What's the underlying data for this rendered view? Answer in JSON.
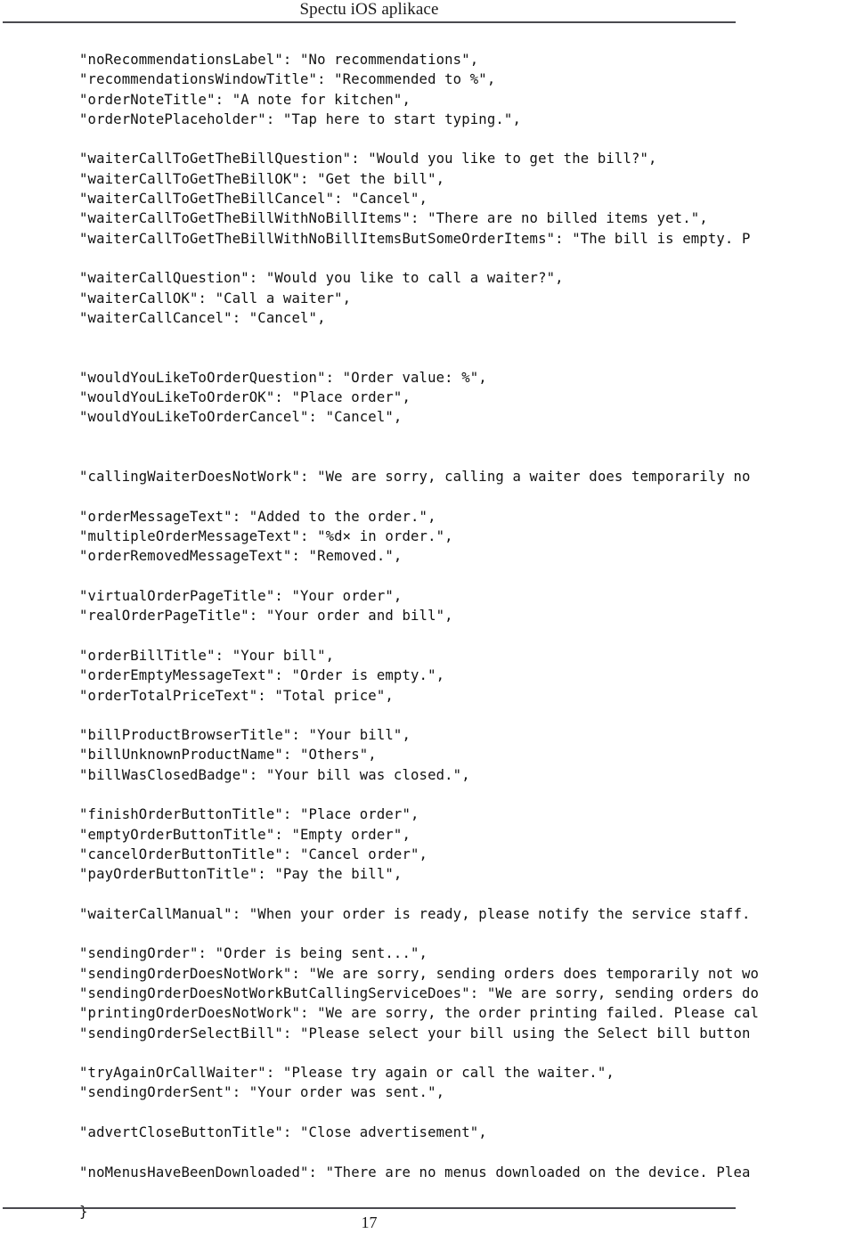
{
  "header": {
    "title": "Spectu iOS aplikace"
  },
  "footer": {
    "page_number": "17"
  },
  "code": {
    "lines": [
      "\"noRecommendationsLabel\": \"No recommendations\",",
      "\"recommendationsWindowTitle\": \"Recommended to %\",",
      "\"orderNoteTitle\": \"A note for kitchen\",",
      "\"orderNotePlaceholder\": \"Tap here to start typing.\",",
      "",
      "\"waiterCallToGetTheBillQuestion\": \"Would you like to get the bill?\",",
      "\"waiterCallToGetTheBillOK\": \"Get the bill\",",
      "\"waiterCallToGetTheBillCancel\": \"Cancel\",",
      "\"waiterCallToGetTheBillWithNoBillItems\": \"There are no billed items yet.\",",
      "\"waiterCallToGetTheBillWithNoBillItemsButSomeOrderItems\": \"The bill is empty. P",
      "",
      "\"waiterCallQuestion\": \"Would you like to call a waiter?\",",
      "\"waiterCallOK\": \"Call a waiter\",",
      "\"waiterCallCancel\": \"Cancel\",",
      "",
      "",
      "\"wouldYouLikeToOrderQuestion\": \"Order value: %\",",
      "\"wouldYouLikeToOrderOK\": \"Place order\",",
      "\"wouldYouLikeToOrderCancel\": \"Cancel\",",
      "",
      "",
      "\"callingWaiterDoesNotWork\": \"We are sorry, calling a waiter does temporarily no",
      "",
      "\"orderMessageText\": \"Added to the order.\",",
      "\"multipleOrderMessageText\": \"%d× in order.\",",
      "\"orderRemovedMessageText\": \"Removed.\",",
      "",
      "\"virtualOrderPageTitle\": \"Your order\",",
      "\"realOrderPageTitle\": \"Your order and bill\",",
      "",
      "\"orderBillTitle\": \"Your bill\",",
      "\"orderEmptyMessageText\": \"Order is empty.\",",
      "\"orderTotalPriceText\": \"Total price\",",
      "",
      "\"billProductBrowserTitle\": \"Your bill\",",
      "\"billUnknownProductName\": \"Others\",",
      "\"billWasClosedBadge\": \"Your bill was closed.\",",
      "",
      "\"finishOrderButtonTitle\": \"Place order\",",
      "\"emptyOrderButtonTitle\": \"Empty order\",",
      "\"cancelOrderButtonTitle\": \"Cancel order\",",
      "\"payOrderButtonTitle\": \"Pay the bill\",",
      "",
      "\"waiterCallManual\": \"When your order is ready, please notify the service staff.",
      "",
      "\"sendingOrder\": \"Order is being sent...\",",
      "\"sendingOrderDoesNotWork\": \"We are sorry, sending orders does temporarily not wo",
      "\"sendingOrderDoesNotWorkButCallingServiceDoes\": \"We are sorry, sending orders do",
      "\"printingOrderDoesNotWork\": \"We are sorry, the order printing failed. Please cal",
      "\"sendingOrderSelectBill\": \"Please select your bill using the Select bill button",
      "",
      "\"tryAgainOrCallWaiter\": \"Please try again or call the waiter.\",",
      "\"sendingOrderSent\": \"Your order was sent.\",",
      "",
      "\"advertCloseButtonTitle\": \"Close advertisement\",",
      "",
      "\"noMenusHaveBeenDownloaded\": \"There are no menus downloaded on the device. Plea",
      "",
      "}"
    ]
  }
}
